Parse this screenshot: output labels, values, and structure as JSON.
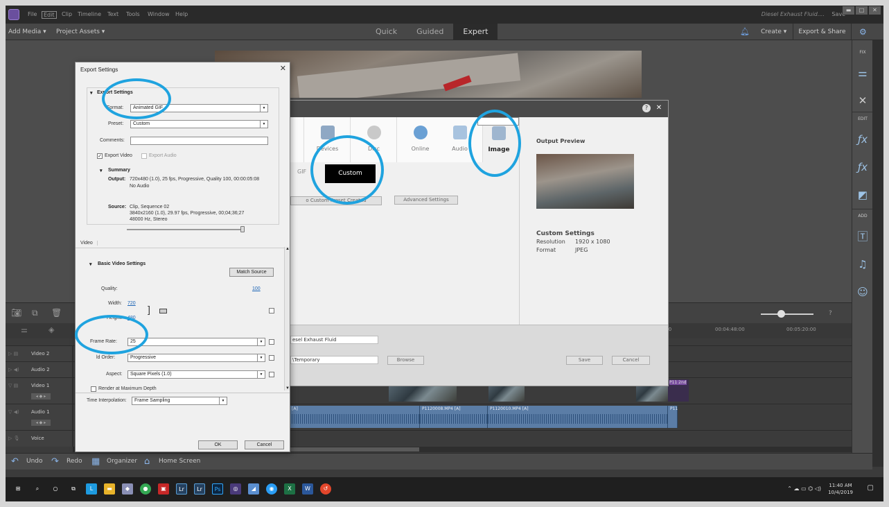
{
  "titlebar": {
    "menus": [
      "File",
      "Edit",
      "Clip",
      "Timeline",
      "Text",
      "Tools",
      "Window",
      "Help"
    ],
    "project_name": "Diesel Exhaust Fluid....",
    "save_label": "Save"
  },
  "toolbar": {
    "add_media": "Add Media ▾",
    "project_assets": "Project Assets ▾",
    "modes": [
      "Quick",
      "Guided",
      "Expert"
    ],
    "create": "Create ▾",
    "export_share": "Export & Share"
  },
  "right_panel": {
    "fix": "FIX",
    "edit": "EDIT",
    "add": "ADD"
  },
  "timeline": {
    "ruler": [
      "00:04:48:00",
      "00:05:20:00"
    ],
    "ruler_left": ":00",
    "tracks": [
      "Video 2",
      "Audio 2",
      "Video 1",
      "Audio 1",
      "Voice"
    ],
    "clips": {
      "a1": "[A]",
      "a2": "P1120008.MP4 [A]",
      "a3": "P1120010.MP4 [A]",
      "a4": "P11",
      "v_end": "P11 2nd"
    }
  },
  "bottombar": {
    "undo": "Undo",
    "redo": "Redo",
    "organizer": "Organizer",
    "home": "Home Screen"
  },
  "taskbar": {
    "time": "11:40 AM",
    "date": "10/4/2019"
  },
  "bg_dialog": {
    "categories": [
      "Devices",
      "Disc",
      "Online",
      "Audio",
      "Image"
    ],
    "gif_tab": "GIF",
    "custom_tab": "Custom",
    "preset_button": "o Custom Preset Created",
    "advanced_button": "Advanced Settings",
    "output_preview": "Output Preview",
    "custom_settings": "Custom Settings",
    "resolution_label": "Resolution",
    "resolution_value": "1920 x 1080",
    "format_label": "Format",
    "format_value": "JPEG",
    "filename_value": "esel Exhaust Fluid",
    "location_value": "\\Temporary",
    "browse": "Browse",
    "save": "Save",
    "cancel": "Cancel"
  },
  "export_settings": {
    "title": "Export Settings",
    "section_export": "Export Settings",
    "format_label": "Format:",
    "format_value": "Animated GIF",
    "preset_label": "Preset:",
    "preset_value": "Custom",
    "comments_label": "Comments:",
    "export_video": "Export Video",
    "export_audio": "Export Audio",
    "summary": "Summary",
    "output_label": "Output:",
    "output_line1": "720x480 (1.0), 25 fps, Progressive, Quality 100, 00:00:05:08",
    "output_line2": "No Audio",
    "source_label": "Source:",
    "source_line1": "Clip, Sequence 02",
    "source_line2": "3840x2160 (1.0), 29.97 fps, Progressive, 00;04;36;27",
    "source_line3": "48000 Hz, Stereo",
    "video_tab": "Video",
    "basic_video": "Basic Video Settings",
    "match_source": "Match Source",
    "quality_label": "Quality:",
    "quality_value": "100",
    "width_label": "Width:",
    "width_value": "720",
    "height_label": "Height:",
    "height_value": "480",
    "frame_rate_label": "Frame Rate:",
    "frame_rate_value": "25",
    "field_order_label": "ld Order:",
    "field_order_value": "Progressive",
    "aspect_label": "Aspect:",
    "aspect_value": "Square Pixels (1.0)",
    "render_max": "Render at Maximum Depth",
    "time_interp_label": "Time Interpolation:",
    "time_interp_value": "Frame Sampling",
    "ok": "OK",
    "cancel": "Cancel"
  },
  "colors": {
    "highlight": "#1fa3df",
    "accent": "#8ab4e8"
  }
}
